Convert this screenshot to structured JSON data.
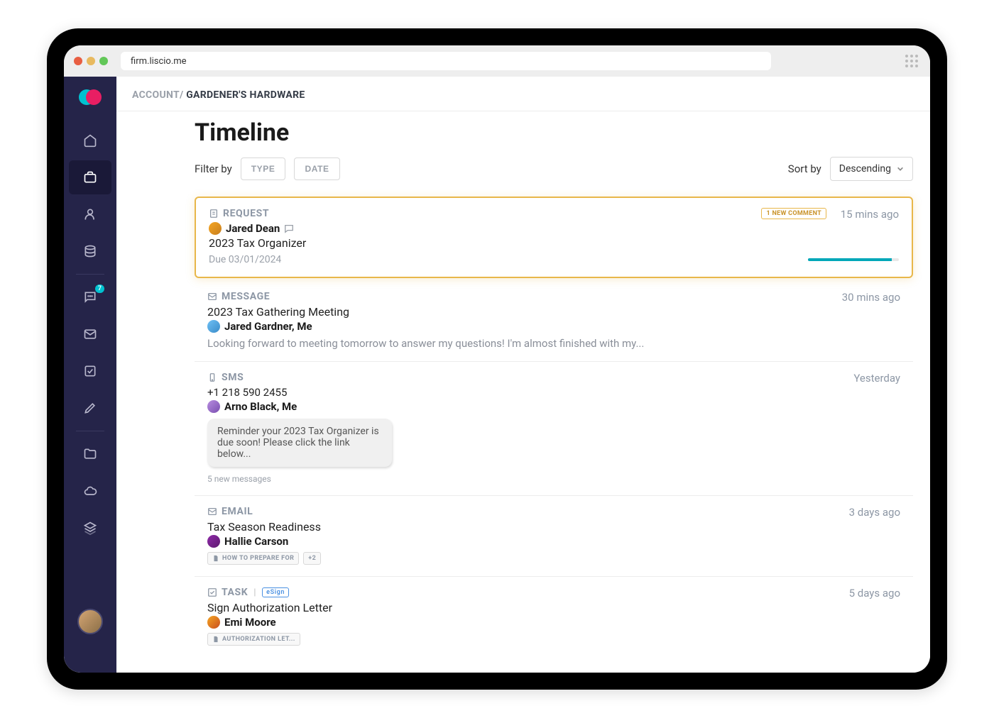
{
  "browser": {
    "url": "firm.liscio.me"
  },
  "breadcrumb": {
    "prefix": "ACCOUNT/",
    "current": "GARDENER'S HARDWARE"
  },
  "page": {
    "title": "Timeline"
  },
  "toolbar": {
    "filter_label": "Filter by",
    "type_btn": "TYPE",
    "date_btn": "DATE",
    "sort_label": "Sort by",
    "sort_value": "Descending"
  },
  "nav": {
    "chat_badge": "7"
  },
  "items": [
    {
      "type": "REQUEST",
      "badge": "1 NEW COMMENT",
      "timestamp": "15 mins ago",
      "person": "Jared Dean",
      "subject": "2023 Tax Organizer",
      "due": "Due 03/01/2024",
      "progress_pct": 92
    },
    {
      "type": "MESSAGE",
      "timestamp": "30 mins ago",
      "subject": "2023 Tax Gathering Meeting",
      "person": "Jared Gardner, Me",
      "preview": "Looking forward to meeting tomorrow to answer my questions! I'm almost finished with my..."
    },
    {
      "type": "SMS",
      "timestamp": "Yesterday",
      "phone": "+1 218 590 2455",
      "person": "Arno Black, Me",
      "bubble": "Reminder your 2023 Tax Organizer is due soon! Please click the link below...",
      "count": "5 new messages"
    },
    {
      "type": "EMAIL",
      "timestamp": "3 days ago",
      "subject": "Tax Season Readiness",
      "person": "Hallie Carson",
      "attachment": "HOW TO PREPARE FOR",
      "attachment_extra": "+2"
    },
    {
      "type": "TASK",
      "esign": "eSign",
      "timestamp": "5 days ago",
      "subject": "Sign Authorization Letter",
      "person": "Emi Moore",
      "attachment": "AUTHORIZATION LET..."
    }
  ]
}
